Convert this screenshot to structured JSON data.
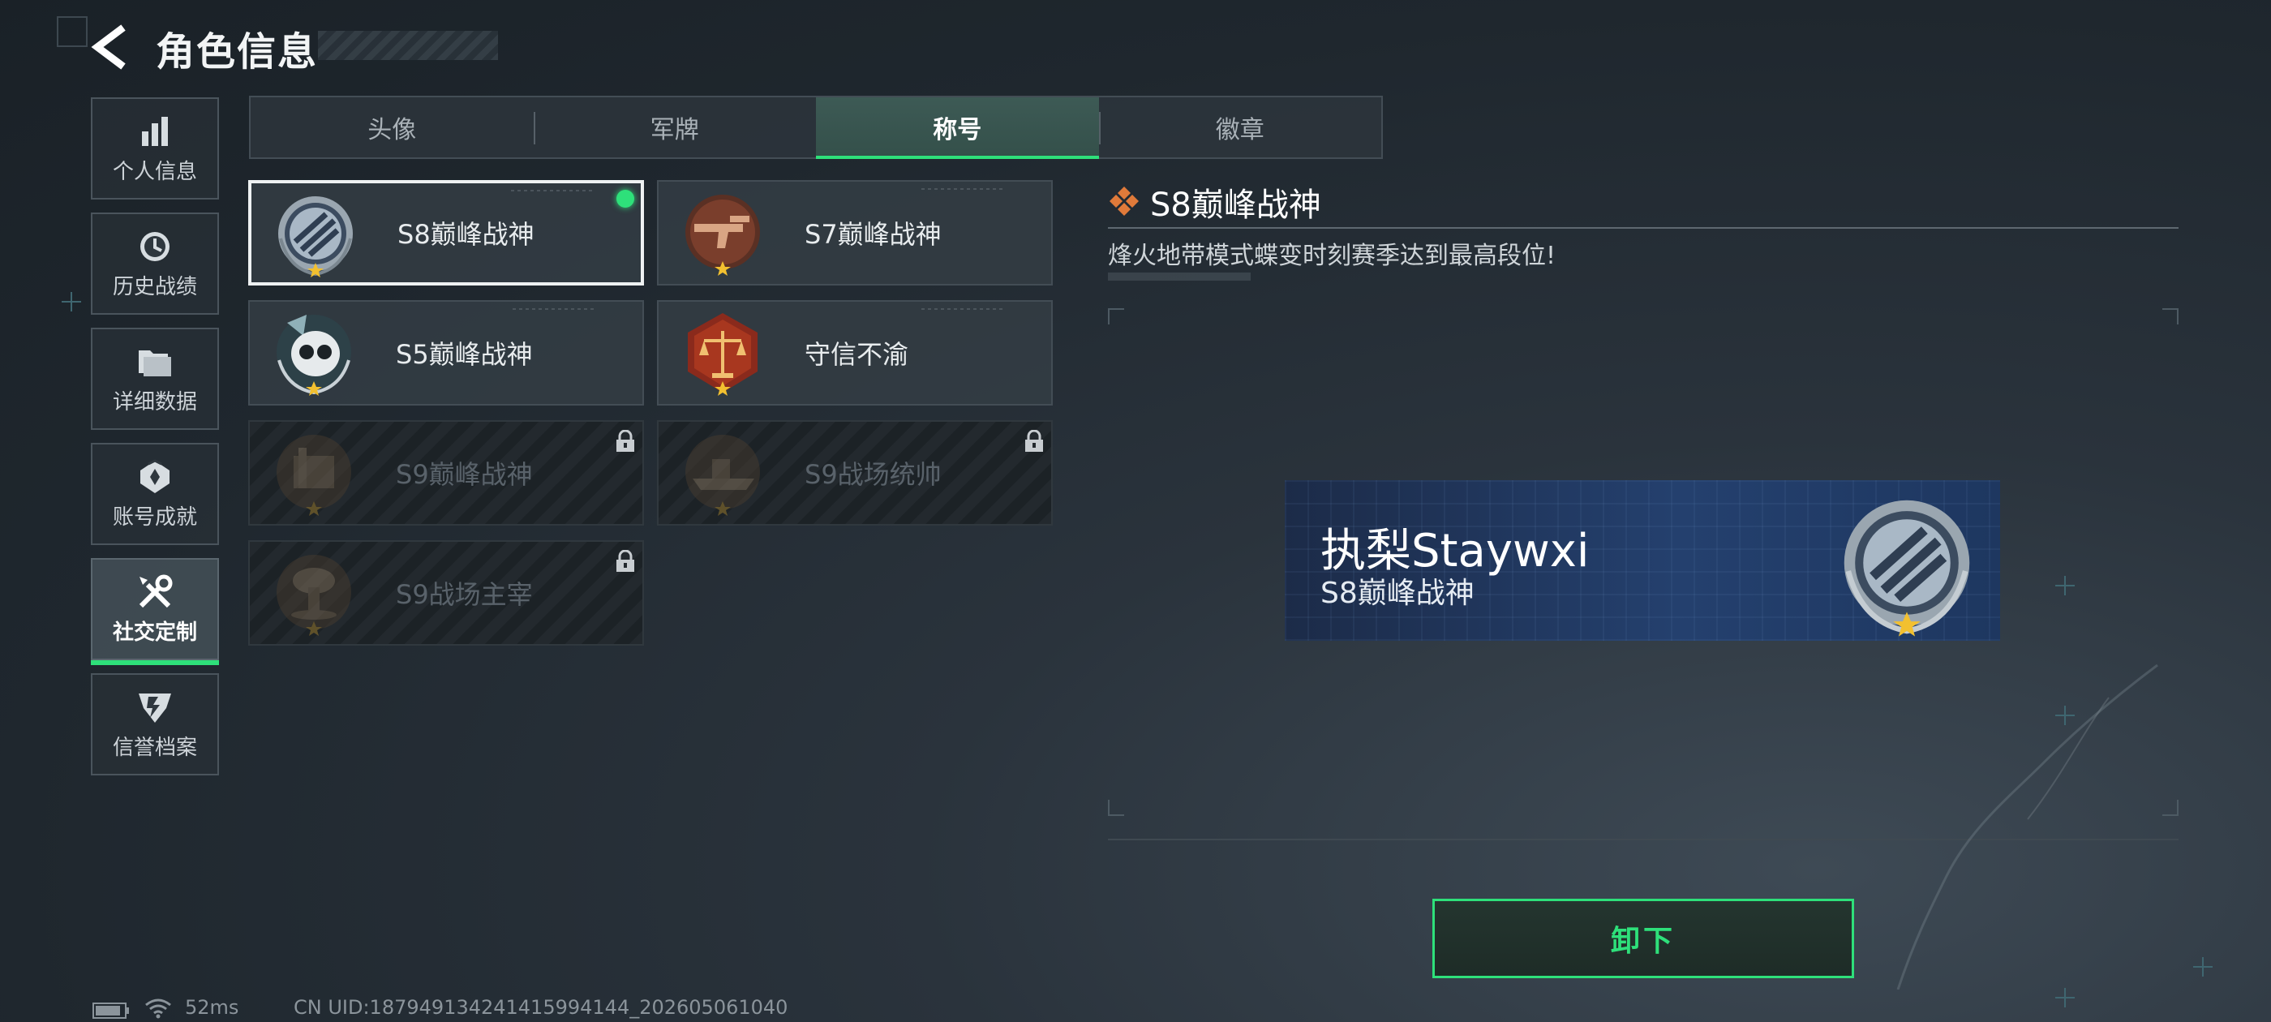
{
  "header": {
    "title": "角色信息"
  },
  "nav": {
    "items": [
      {
        "label": "个人信息",
        "icon": "bar-chart-icon"
      },
      {
        "label": "历史战绩",
        "icon": "clock-icon"
      },
      {
        "label": "详细数据",
        "icon": "folder-icon"
      },
      {
        "label": "账号成就",
        "icon": "achievement-icon"
      },
      {
        "label": "社交定制",
        "icon": "tools-icon",
        "active": true
      },
      {
        "label": "信誉档案",
        "icon": "credit-badge-icon"
      }
    ]
  },
  "tabs": [
    {
      "label": "头像"
    },
    {
      "label": "军牌"
    },
    {
      "label": "称号",
      "active": true
    },
    {
      "label": "徽章"
    }
  ],
  "titles": [
    {
      "name": "S8巅峰战神",
      "locked": false,
      "selected": true,
      "equipped": true,
      "badge": "s8-emblem-icon"
    },
    {
      "name": "S7巅峰战神",
      "locked": false,
      "badge": "s7-gun-emblem-icon"
    },
    {
      "name": "S5巅峰战神",
      "locked": false,
      "badge": "s5-skull-emblem-icon"
    },
    {
      "name": "守信不渝",
      "locked": false,
      "badge": "scales-emblem-icon"
    },
    {
      "name": "S9巅峰战神",
      "locked": true,
      "badge": "s9-building-emblem-icon"
    },
    {
      "name": "S9战场统帅",
      "locked": true,
      "badge": "s9-ship-emblem-icon"
    },
    {
      "name": "S9战场主宰",
      "locked": true,
      "badge": "s9-explosion-emblem-icon"
    }
  ],
  "detail": {
    "title": "S8巅峰战神",
    "description": "烽火地带模式蝶变时刻赛季达到最高段位!",
    "preview": {
      "player_name": "执梨Staywxi",
      "title": "S8巅峰战神"
    },
    "action_label": "卸下"
  },
  "status": {
    "ping": "52ms",
    "uid": "CN UID:1879491342414159941​44_202605061040"
  },
  "colors": {
    "accent": "#2ee07a",
    "detail_icon": "#e07a3a"
  }
}
